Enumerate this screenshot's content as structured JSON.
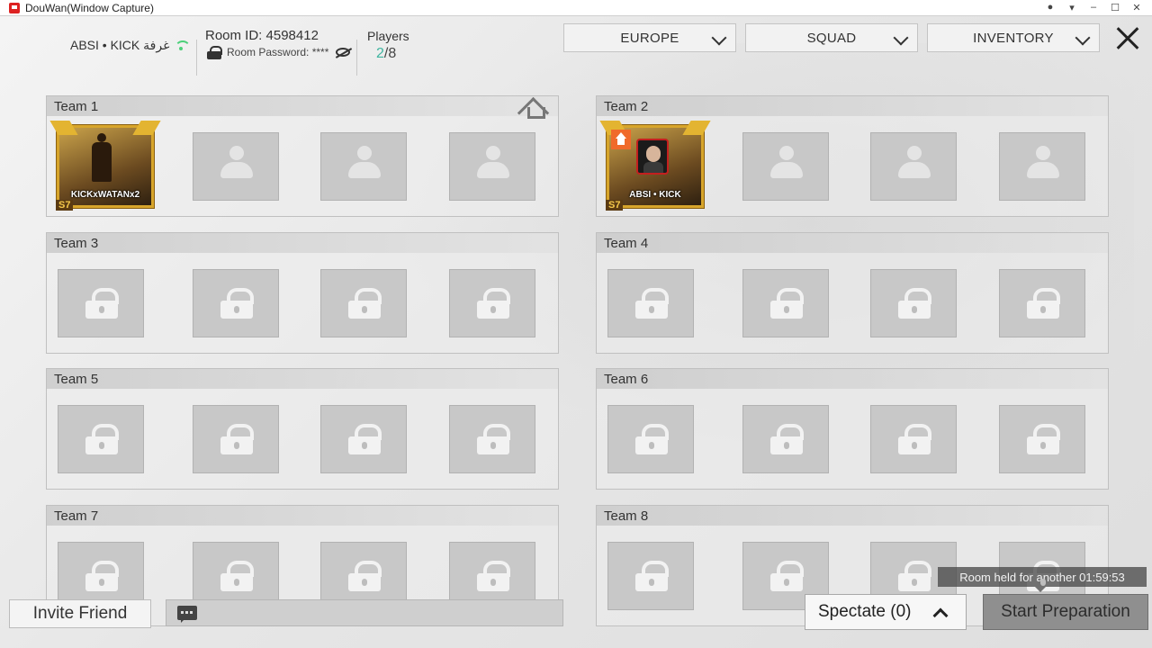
{
  "window": {
    "title": "DouWan(Window Capture)"
  },
  "header": {
    "host_name": "ABSI • KICK غرفة",
    "room_id": "Room ID: 4598412",
    "room_password_label": "Room Password: ****",
    "players_label": "Players",
    "players_current": "2",
    "players_max": "/8",
    "region": "EUROPE",
    "mode": "SQUAD",
    "inventory": "INVENTORY"
  },
  "teams": [
    {
      "name": "Team 1",
      "slots": [
        {
          "state": "player",
          "tag": "KICKxWATANx2",
          "badge": "S7"
        },
        {
          "state": "empty"
        },
        {
          "state": "empty"
        },
        {
          "state": "empty"
        }
      ]
    },
    {
      "name": "Team 2",
      "slots": [
        {
          "state": "player",
          "tag": "ABSI • KICK",
          "badge": "S7",
          "host": true
        },
        {
          "state": "empty"
        },
        {
          "state": "empty"
        },
        {
          "state": "empty"
        }
      ]
    },
    {
      "name": "Team 3",
      "slots": [
        {
          "state": "locked"
        },
        {
          "state": "locked"
        },
        {
          "state": "locked"
        },
        {
          "state": "locked"
        }
      ]
    },
    {
      "name": "Team 4",
      "slots": [
        {
          "state": "locked"
        },
        {
          "state": "locked"
        },
        {
          "state": "locked"
        },
        {
          "state": "locked"
        }
      ]
    },
    {
      "name": "Team 5",
      "slots": [
        {
          "state": "locked"
        },
        {
          "state": "locked"
        },
        {
          "state": "locked"
        },
        {
          "state": "locked"
        }
      ]
    },
    {
      "name": "Team 6",
      "slots": [
        {
          "state": "locked"
        },
        {
          "state": "locked"
        },
        {
          "state": "locked"
        },
        {
          "state": "locked"
        }
      ]
    },
    {
      "name": "Team 7",
      "slots": [
        {
          "state": "locked"
        },
        {
          "state": "locked"
        },
        {
          "state": "locked"
        },
        {
          "state": "locked"
        }
      ]
    },
    {
      "name": "Team 8",
      "slots": [
        {
          "state": "locked"
        },
        {
          "state": "locked"
        },
        {
          "state": "locked"
        },
        {
          "state": "locked"
        }
      ]
    }
  ],
  "footer": {
    "invite_label": "Invite Friend",
    "spectate_label": "Spectate (0)",
    "start_label": "Start Preparation",
    "timer_text": "Room held for another 01:59:53"
  },
  "colors": {
    "players_current": "#3fb5a0",
    "gold_frame": "#d7a52b",
    "host_badge": "#f06a2a"
  }
}
